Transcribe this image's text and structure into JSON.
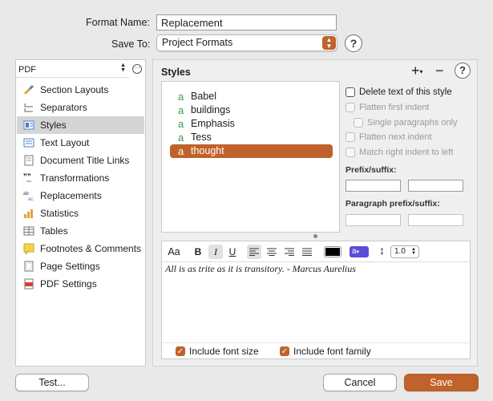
{
  "header": {
    "format_name_label": "Format Name:",
    "format_name_value": "Replacement",
    "save_to_label": "Save To:",
    "save_to_value": "Project Formats",
    "help_glyph": "?"
  },
  "sidebar": {
    "format_select": "PDF",
    "items": [
      {
        "label": "Section Layouts",
        "icon": "brush-icon"
      },
      {
        "label": "Separators",
        "icon": "separator-icon"
      },
      {
        "label": "Styles",
        "icon": "styles-icon",
        "selected": true
      },
      {
        "label": "Text Layout",
        "icon": "text-layout-icon"
      },
      {
        "label": "Document Title Links",
        "icon": "document-icon"
      },
      {
        "label": "Transformations",
        "icon": "transformations-icon"
      },
      {
        "label": "Replacements",
        "icon": "replacements-icon"
      },
      {
        "label": "Statistics",
        "icon": "statistics-icon"
      },
      {
        "label": "Tables",
        "icon": "table-icon"
      },
      {
        "label": "Footnotes & Comments",
        "icon": "footnote-icon"
      },
      {
        "label": "Page Settings",
        "icon": "page-icon"
      },
      {
        "label": "PDF Settings",
        "icon": "pdf-icon"
      }
    ]
  },
  "styles_pane": {
    "title": "Styles",
    "add_glyph": "+",
    "remove_glyph": "−",
    "help_glyph": "?",
    "items": [
      {
        "label": "Babel",
        "glyph": "a"
      },
      {
        "label": "buildings",
        "glyph": "a"
      },
      {
        "label": "Emphasis",
        "glyph": "a"
      },
      {
        "label": "Tess",
        "glyph": "a"
      },
      {
        "label": "thought",
        "glyph": "a",
        "selected": true
      }
    ],
    "options": {
      "delete_text": "Delete text of this style",
      "flatten_first_indent": "Flatten first indent",
      "single_paragraphs_only": "Single paragraphs only",
      "flatten_next_indent": "Flatten next indent",
      "match_right_indent": "Match right indent to left",
      "prefix_suffix_label": "Prefix/suffix:",
      "paragraph_prefix_suffix_label": "Paragraph prefix/suffix:"
    }
  },
  "editor": {
    "font_button": "Aa",
    "bold": "B",
    "italic": "I",
    "underline": "U",
    "highlight_glyph": "a",
    "line_spacing": "1.0",
    "content": "All is as trite as it is transitory. - Marcus Aurelius",
    "text_color": "#000000",
    "highlight_color": "#5b4bd6",
    "include_font_size": "Include font size",
    "include_font_family": "Include font family"
  },
  "footer": {
    "test_button": "Test...",
    "cancel_button": "Cancel",
    "save_button": "Save"
  },
  "colors": {
    "accent": "#c0622b",
    "style_glyph": "#3a9a4a"
  }
}
